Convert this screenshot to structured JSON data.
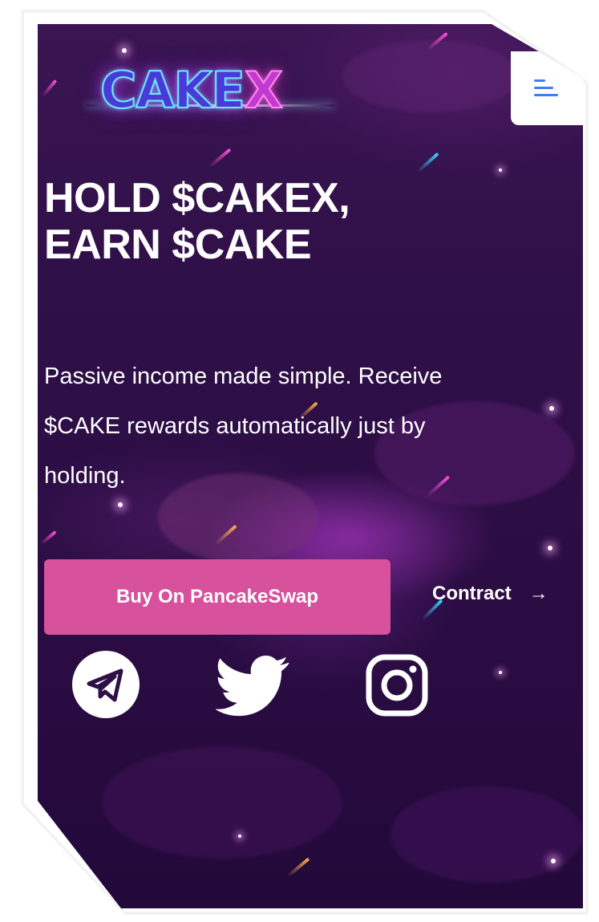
{
  "brand": {
    "logo_main": "CAKE",
    "logo_accent": "X"
  },
  "header": {
    "menu_icon": "hamburger-menu-icon"
  },
  "hero": {
    "title_line1": "HOLD $CAKEX,",
    "title_line2": "EARN $CAKE",
    "description_line1": "Passive income made simple. Receive",
    "description_line2": "$CAKE rewards automatically just by",
    "description_line3": "holding."
  },
  "actions": {
    "buy_label": "Buy On PancakeSwap",
    "contract_label": "Contract",
    "contract_arrow": "→"
  },
  "social": [
    {
      "icon": "telegram-icon"
    },
    {
      "icon": "twitter-icon"
    },
    {
      "icon": "instagram-icon"
    }
  ],
  "colors": {
    "background": "#2e0f47",
    "buy_button": "#d7519d",
    "menu_icon": "#3b7ff0",
    "text": "#ffffff"
  }
}
